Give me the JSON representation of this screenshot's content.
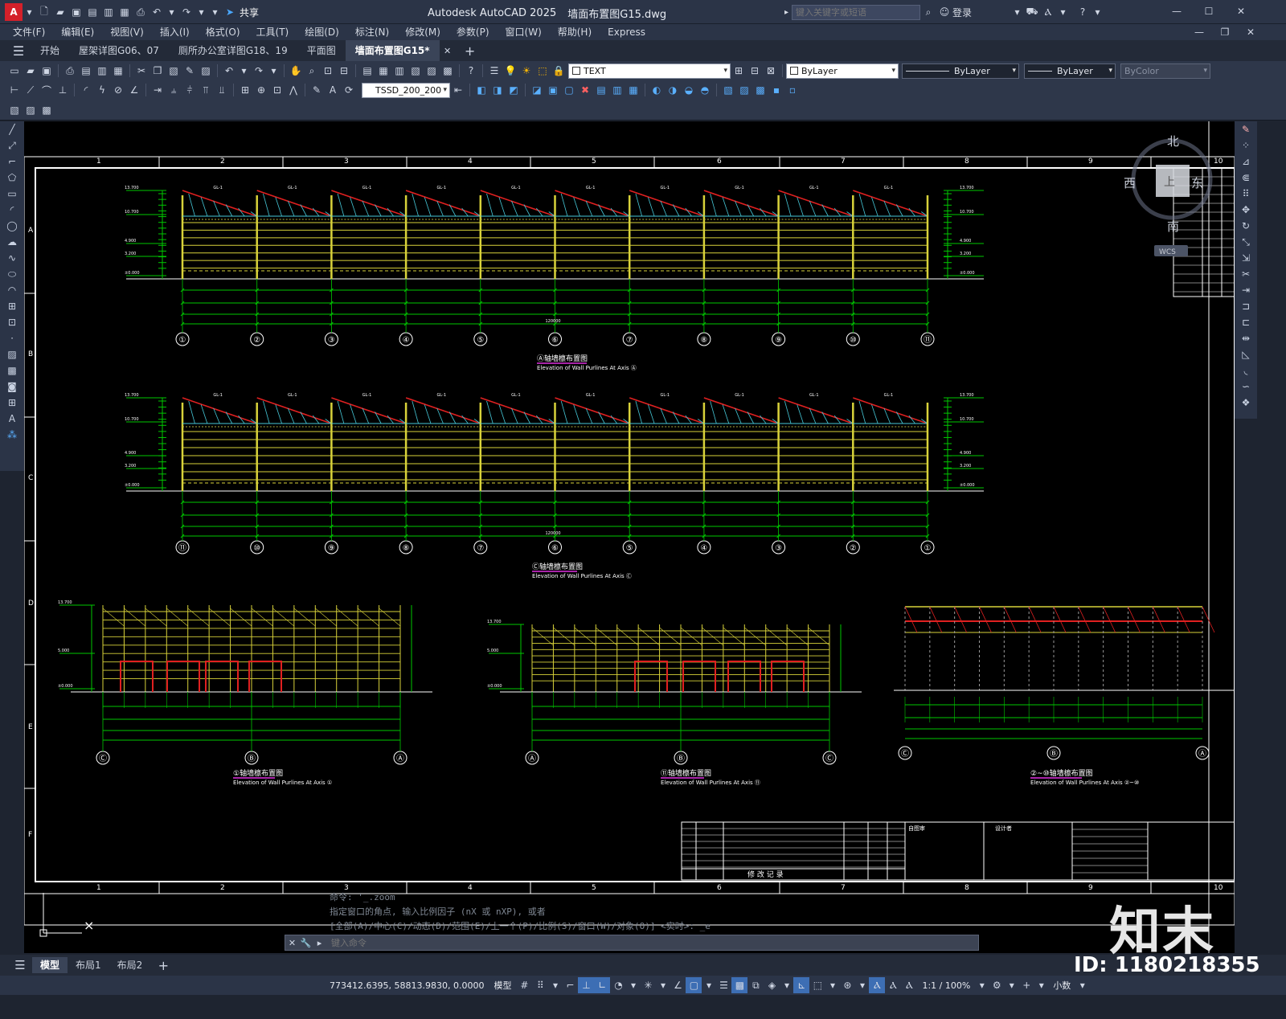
{
  "titlebar": {
    "app_title": "Autodesk AutoCAD 2025",
    "file_title": "墙面布置图G15.dwg",
    "share_label": "共享",
    "search_placeholder": "键入关键字或短语",
    "login_label": "登录"
  },
  "menu": [
    "文件(F)",
    "编辑(E)",
    "视图(V)",
    "插入(I)",
    "格式(O)",
    "工具(T)",
    "绘图(D)",
    "标注(N)",
    "修改(M)",
    "参数(P)",
    "窗口(W)",
    "帮助(H)",
    "Express"
  ],
  "tabs": [
    {
      "label": "开始",
      "active": false
    },
    {
      "label": "屋架详图G06、07",
      "active": false
    },
    {
      "label": "厕所办公室详图G18、19",
      "active": false
    },
    {
      "label": "平面图",
      "active": false
    },
    {
      "label": "墙面布置图G15*",
      "active": true
    }
  ],
  "toolbar": {
    "text_style": "TEXT",
    "layer_color": "ByLayer",
    "linetype": "ByLayer",
    "lineweight": "ByLayer",
    "plot_style": "ByColor",
    "dim_style": "TSSD_200_200"
  },
  "viewcube": {
    "north": "北",
    "west": "西",
    "south": "南",
    "top": "上",
    "east": "东",
    "wcs": "WCS"
  },
  "drawing": {
    "col_grid": [
      "1",
      "2",
      "3",
      "4",
      "5",
      "6",
      "7",
      "8",
      "9",
      "10"
    ],
    "row_grid": [
      "A",
      "B",
      "C",
      "D",
      "E",
      "F"
    ],
    "titles": [
      {
        "cn": "Ⓐ轴墙檩布置图",
        "en": "Elevation of Wall Purlines At Axis Ⓐ"
      },
      {
        "cn": "Ⓒ轴墙檩布置图",
        "en": "Elevation of Wall Purlines At Axis Ⓒ"
      },
      {
        "cn": "①轴墙檩布置图",
        "en": "Elevation of Wall Purlines At Axis ①"
      },
      {
        "cn": "⑪轴墙檩布置图",
        "en": "Elevation of Wall Purlines At Axis ⑪"
      },
      {
        "cn": "②~⑩轴墙檩布置图",
        "en": "Elevation of Wall Purlines At Axis ②~⑩"
      }
    ],
    "axis_top": [
      "①",
      "②",
      "③",
      "④",
      "⑤",
      "⑥",
      "⑦",
      "⑧",
      "⑨",
      "⑩",
      "⑪"
    ],
    "axis_mid": [
      "⑪",
      "⑩",
      "⑨",
      "⑧",
      "⑦",
      "⑥",
      "⑤",
      "④",
      "③",
      "②",
      "①"
    ],
    "axis_d1": [
      "Ⓒ",
      "Ⓑ",
      "Ⓐ"
    ],
    "axis_d2": [
      "Ⓐ",
      "Ⓑ",
      "Ⓒ"
    ],
    "axis_d3": [
      "Ⓒ",
      "Ⓑ",
      "Ⓐ"
    ],
    "revision_label": "修  改  记  录",
    "title_block": {
      "left": "自图审",
      "mid": "设计者"
    },
    "elevations": {
      "ridge": "13.700",
      "eave": "10.700",
      "mid": "4.900",
      "low": "3.200",
      "ground": "±0.000",
      "side_low": "1.600",
      "side_mid": "5.000"
    },
    "total_dim": "120000"
  },
  "command": {
    "history": [
      "命令: '_.zoom",
      "指定窗口的角点, 输入比例因子 (nX 或 nXP), 或者",
      "[全部(A)/中心(C)/动态(D)/范围(E)/上一个(P)/比例(S)/窗口(W)/对象(O)] <实时>: _e"
    ],
    "placeholder": "键入命令"
  },
  "layouts": [
    "模型",
    "布局1",
    "布局2"
  ],
  "status": {
    "coords": "773412.6395, 58813.9830, 0.0000",
    "model": "模型",
    "scale": "1:1 / 100%",
    "units": "小数"
  },
  "watermark": {
    "logo": "知末",
    "id": "ID: 1180218355"
  },
  "colors": {
    "grid_green": "#00c800",
    "yellow": "#d8d23a",
    "red": "#e02020",
    "cyan": "#46c8d8",
    "white": "#ffffff"
  }
}
